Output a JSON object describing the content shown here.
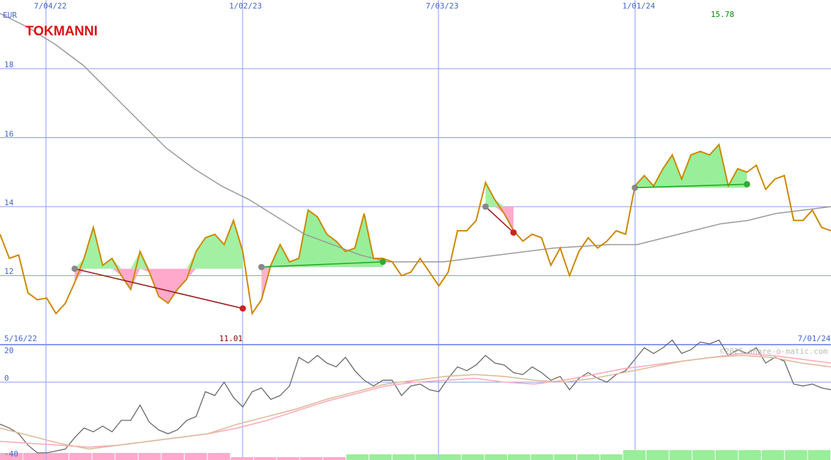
{
  "chart_data": [
    {
      "type": "line",
      "title": "TOKMANNI",
      "currency": "EUR",
      "start_date_label": "5/16/22",
      "end_date_label": "7/01/24",
      "date_ticks": [
        "7/04/22",
        "1/02/23",
        "7/03/23",
        "1/01/24"
      ],
      "y_ticks": [
        12,
        14,
        16,
        18
      ],
      "ylim": [
        10,
        20
      ],
      "price_series": {
        "name": "Price",
        "values": [
          13.2,
          12.5,
          12.6,
          11.5,
          11.3,
          11.35,
          10.9,
          11.2,
          11.8,
          12.5,
          13.4,
          12.3,
          12.5,
          12.0,
          11.6,
          12.7,
          12.1,
          11.4,
          11.2,
          11.6,
          11.9,
          12.7,
          13.1,
          13.2,
          12.9,
          13.6,
          12.7,
          10.9,
          11.3,
          12.3,
          12.9,
          12.4,
          12.5,
          13.9,
          13.7,
          13.2,
          13.0,
          12.7,
          12.8,
          13.8,
          12.5,
          12.5,
          12.4,
          12.0,
          12.1,
          12.5,
          12.1,
          11.7,
          12.1,
          13.3,
          13.3,
          13.6,
          14.7,
          14.2,
          13.8,
          13.3,
          13.0,
          13.2,
          13.1,
          12.3,
          12.8,
          12.0,
          12.7,
          13.1,
          12.8,
          13.0,
          13.3,
          13.2,
          14.6,
          14.9,
          14.6,
          15.1,
          15.5,
          14.8,
          15.5,
          15.6,
          15.5,
          15.8,
          14.6,
          15.1,
          15.0,
          15.2,
          14.5,
          14.8,
          14.9,
          13.6,
          13.6,
          13.9,
          13.4,
          13.3
        ],
        "color": "#cc8800"
      },
      "moving_average": {
        "name": "Moving average",
        "values": [
          19.6,
          19.2,
          18.7,
          18.1,
          17.3,
          16.5,
          15.7,
          15.1,
          14.6,
          14.2,
          13.7,
          13.2,
          12.9,
          12.6,
          12.4,
          12.4,
          12.4,
          12.5,
          12.6,
          12.7,
          12.8,
          12.85,
          12.9,
          12.9,
          13.1,
          13.3,
          13.5,
          13.6,
          13.8,
          13.9,
          14.0
        ],
        "color": "#999999"
      },
      "fills": {
        "gain_color": "#99ee99",
        "loss_color": "#ffaacc"
      },
      "trades": [
        {
          "entry": 12.2,
          "exit": 11.05,
          "outcome": "loss"
        },
        {
          "entry": 12.25,
          "exit": 12.4,
          "outcome": "gain"
        },
        {
          "entry": 14.0,
          "exit": 13.25,
          "outcome": "loss"
        },
        {
          "entry": 14.55,
          "exit": 14.65,
          "outcome": "gain"
        }
      ],
      "annotations": {
        "low": "11.01",
        "high": "15.78"
      },
      "gridlines": true
    },
    {
      "type": "line",
      "title": "",
      "y_ticks": [
        20,
        0,
        -40
      ],
      "ylim": [
        -40,
        20
      ],
      "series": [
        {
          "values": [
            -22,
            -24,
            -27,
            -33,
            -37,
            -37,
            -36,
            -35,
            -29,
            -24,
            -26,
            -23,
            -26,
            -20,
            -20,
            -12,
            -21,
            -25,
            -27,
            -25,
            -20,
            -18,
            -5,
            -7,
            0,
            -8,
            -13,
            -5,
            -3,
            -9,
            -7,
            -2,
            13,
            10,
            14,
            10,
            8,
            13,
            6,
            1,
            -2,
            1,
            1,
            -7,
            -2,
            -1,
            -4,
            -5,
            2,
            8,
            6,
            9,
            14,
            10,
            9,
            5,
            4,
            8,
            5,
            1,
            3,
            -4,
            2,
            5,
            2,
            0,
            4,
            6,
            12,
            18,
            15,
            18,
            22,
            15,
            17,
            21,
            20,
            22,
            14,
            17,
            15,
            18,
            10,
            13,
            11,
            -1,
            -2,
            -1,
            -3,
            -4
          ],
          "color": "#666666"
        },
        {
          "values": [
            -31,
            -32,
            -33,
            -34,
            -33,
            -31,
            -29,
            -27,
            -24,
            -20,
            -15,
            -10,
            -6,
            -2,
            0,
            1,
            2,
            0,
            -1,
            1,
            4,
            7,
            9,
            11,
            13,
            15,
            14,
            12,
            10
          ],
          "color": "#ffaabb"
        },
        {
          "values": [
            -24,
            -28,
            -32,
            -35,
            -33,
            -31,
            -29,
            -27,
            -22,
            -18,
            -14,
            -9,
            -5,
            -1,
            1,
            3,
            4,
            3,
            1,
            0,
            2,
            5,
            8,
            11,
            13,
            14,
            13,
            10,
            8
          ],
          "color": "#ddbb99"
        }
      ],
      "volume_bars": {
        "positive_color": "#99ee99",
        "negative_color": "#ffaacc"
      },
      "watermark": "©2025 share-o-matic.com"
    }
  ]
}
